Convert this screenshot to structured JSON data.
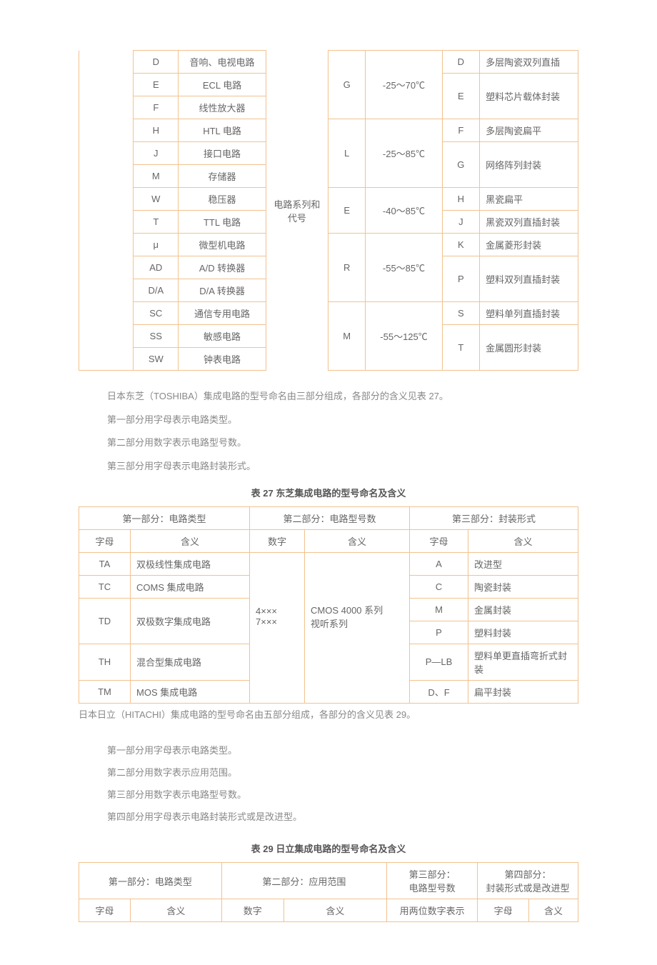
{
  "table1": {
    "col2_header": "电路系列和代号",
    "rows_left": [
      {
        "code": "D",
        "desc": "音响、电视电路"
      },
      {
        "code": "E",
        "desc": "ECL 电路"
      },
      {
        "code": "F",
        "desc": "线性放大器"
      },
      {
        "code": "H",
        "desc": "HTL 电路"
      },
      {
        "code": "J",
        "desc": "接口电路"
      },
      {
        "code": "M",
        "desc": "存储器"
      },
      {
        "code": "W",
        "desc": "稳压器"
      },
      {
        "code": "T",
        "desc": "TTL 电路"
      },
      {
        "code": "μ",
        "desc": "微型机电路"
      },
      {
        "code": "AD",
        "desc": "A/D 转换器"
      },
      {
        "code": "D/A",
        "desc": "D/A 转换器"
      },
      {
        "code": "SC",
        "desc": "通信专用电路"
      },
      {
        "code": "SS",
        "desc": "敏感电路"
      },
      {
        "code": "SW",
        "desc": "钟表电路"
      }
    ],
    "temps": [
      {
        "code": "G",
        "range": "-25～70℃"
      },
      {
        "code": "L",
        "range": "-25～85℃"
      },
      {
        "code": "E",
        "range": "-40～85℃"
      },
      {
        "code": "R",
        "range": "-55～85℃"
      },
      {
        "code": "M",
        "range": "-55～125℃"
      }
    ],
    "packages": [
      {
        "code": "D",
        "desc": "多层陶瓷双列直插"
      },
      {
        "code": "E",
        "desc": "塑料芯片载体封装"
      },
      {
        "code": "F",
        "desc": "多层陶瓷扁平"
      },
      {
        "code": "G",
        "desc": "网络阵列封装"
      },
      {
        "code": "H",
        "desc": "黑瓷扁平"
      },
      {
        "code": "J",
        "desc": "黑瓷双列直插封装"
      },
      {
        "code": "K",
        "desc": "金属菱形封装"
      },
      {
        "code": "P",
        "desc": "塑料双列直插封装"
      },
      {
        "code": "S",
        "desc": "塑料单列直插封装"
      },
      {
        "code": "T",
        "desc": "金属圆形封装"
      }
    ]
  },
  "para1": {
    "l1": "日本东芝（TOSHIBA）集成电路的型号命名由三部分组成，各部分的含义见表 27。",
    "l2": "第一部分用字母表示电路类型。",
    "l3": "第二部分用数字表示电路型号数。",
    "l4": "第三部分用字母表示电路封装形式。"
  },
  "caption27": "表 27 东芝集成电路的型号命名及含义",
  "table27": {
    "h1": "第一部分：电路类型",
    "h2": "第二部分：电路型号数",
    "h3": "第三部分：封装形式",
    "sub_letter": "字母",
    "sub_meaning": "含义",
    "sub_number": "数字",
    "p2_num": "4×××\n7×××",
    "p2_meaning": "CMOS 4000 系列\n视听系列",
    "p1": [
      {
        "c": "TA",
        "m": "双极线性集成电路"
      },
      {
        "c": "TC",
        "m": "COMS 集成电路"
      },
      {
        "c": "TD",
        "m": "双极数字集成电路"
      },
      {
        "c": "TH",
        "m": "混合型集成电路"
      },
      {
        "c": "TM",
        "m": "MOS 集成电路"
      }
    ],
    "p3": [
      {
        "c": "A",
        "m": "改进型"
      },
      {
        "c": "C",
        "m": "陶瓷封装"
      },
      {
        "c": "M",
        "m": "金属封装"
      },
      {
        "c": "P",
        "m": "塑料封装"
      },
      {
        "c": "P—LB",
        "m": "塑料单更直插弯折式封装"
      },
      {
        "c": "D、F",
        "m": "扁平封装"
      }
    ]
  },
  "para2_intro": "日本日立（HITACHI）集成电路的型号命名由五部分组成，各部分的含义见表 29。",
  "para2": {
    "l1": "第一部分用字母表示电路类型。",
    "l2": "第二部分用数字表示应用范围。",
    "l3": "第三部分用数字表示电路型号数。",
    "l4": "第四部分用字母表示电路封装形式或是改进型。"
  },
  "caption29": "表 29 日立集成电路的型号命名及含义",
  "table29": {
    "h1": "第一部分：电路类型",
    "h2": "第二部分：应用范围",
    "h3a": "第三部分：",
    "h3b": "电路型号数",
    "h4a": "第四部分：",
    "h4b": "封装形式或是改进型",
    "sub_letter": "字母",
    "sub_meaning": "含义",
    "sub_number": "数字",
    "mid": "用两位数字表示"
  }
}
